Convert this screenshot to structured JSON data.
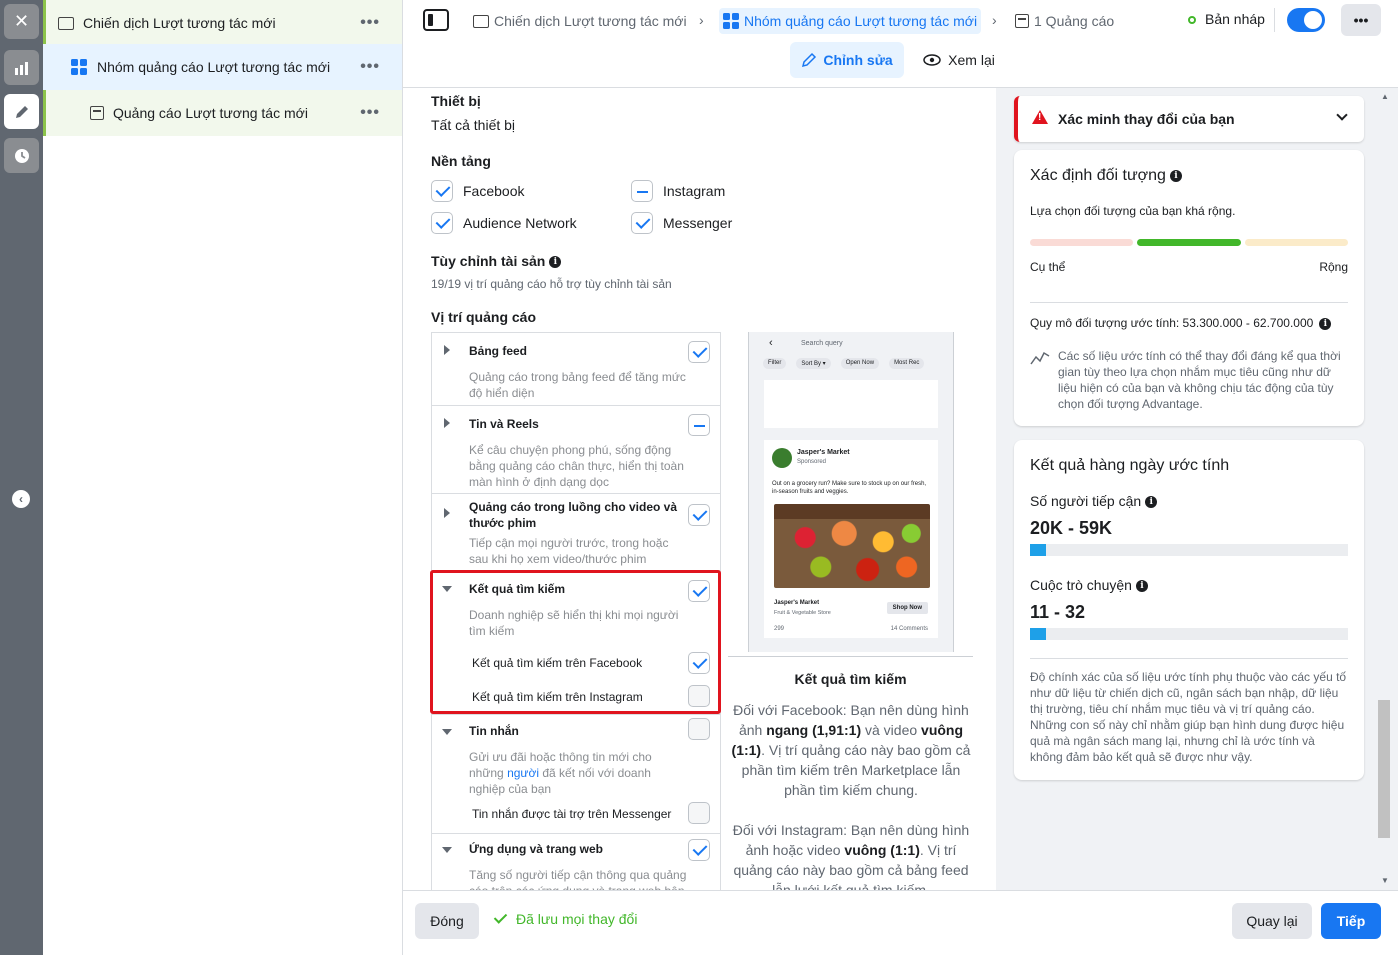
{
  "tree": {
    "campaign": "Chiến dịch Lượt tương tác mới",
    "adset": "Nhóm quảng cáo Lượt tương tác mới",
    "ad": "Quảng cáo Lượt tương tác mới",
    "more": "•••"
  },
  "rail": {
    "close": "✕",
    "collapse": "‹"
  },
  "breadcrumb": {
    "campaign": "Chiến dịch Lượt tương tác mới",
    "adset": "Nhóm quảng cáo Lượt tương tác mới",
    "ad": "1 Quảng cáo",
    "sep": "›"
  },
  "status": {
    "text": "Bản nháp",
    "more": "•••"
  },
  "modes": {
    "edit": "Chỉnh sửa",
    "review": "Xem lại"
  },
  "devices": {
    "label": "Thiết bị",
    "value": "Tất cả thiết bị"
  },
  "platforms": {
    "label": "Nền tảng",
    "items": [
      {
        "label": "Facebook",
        "state": "checked"
      },
      {
        "label": "Instagram",
        "state": "indeterminate"
      },
      {
        "label": "Audience Network",
        "state": "checked"
      },
      {
        "label": "Messenger",
        "state": "checked"
      }
    ]
  },
  "asset_custom": {
    "label": "Tùy chỉnh tài sản",
    "note": "19/19 vị trí quảng cáo hỗ trợ tùy chỉnh tài sản"
  },
  "placements": {
    "label": "Vị trí quảng cáo",
    "items": [
      {
        "title": "Bảng feed",
        "desc": "Quảng cáo trong bảng feed để tăng mức độ hiển diện",
        "state": "checked"
      },
      {
        "title": "Tin và Reels",
        "desc": "Kể câu chuyện phong phú, sống động bằng quảng cáo chân thực, hiển thị toàn màn hình ở định dạng dọc",
        "state": "indeterminate"
      },
      {
        "title": "Quảng cáo trong luồng cho video và thước phim",
        "desc": "Tiếp cận mọi người trước, trong hoặc sau khi họ xem video/thước phim",
        "state": "checked"
      },
      {
        "title": "Kết quả tìm kiếm",
        "desc": "Doanh nghiệp sẽ hiển thị khi mọi người tìm kiếm",
        "state": "checked",
        "sub": [
          {
            "label": "Kết quả tìm kiếm trên Facebook",
            "state": "checked"
          },
          {
            "label": "Kết quả tìm kiếm trên Instagram",
            "state": "off"
          }
        ]
      },
      {
        "title": "Tin nhắn",
        "desc_a": "Gửi ưu đãi hoặc thông tin mới cho những",
        "desc_link": "người",
        "desc_b": "đã kết nối với doanh nghiệp của bạn",
        "state": "off",
        "sub": [
          {
            "label": "Tin nhắn được tài trợ trên Messenger",
            "state": "off"
          }
        ]
      },
      {
        "title": "Ứng dụng và trang web",
        "desc": "Tăng số người tiếp cận thông qua quảng cáo trên các ứng dụng và trang web bên",
        "state": "checked"
      }
    ]
  },
  "preview": {
    "search": "Search query",
    "filters": [
      "Filter",
      "Sort By ▾",
      "Open Now",
      "Most Rec"
    ],
    "advertiser": "Jasper's Market",
    "sponsored": "Sponsored",
    "post_text": "Out on a grocery run? Make sure to stock up on our fresh, in-season fruits and veggies.",
    "store_name": "Jasper's Market",
    "store_sub": "Fruit & Vegetable Store",
    "cta": "Shop Now",
    "reactions": "299",
    "comments": "14 Comments",
    "caption": "Kết quả tìm kiếm",
    "para1_a": "Đối với Facebook: Bạn nên dùng hình ảnh",
    "para1_b1": "ngang (1,91:1)",
    "para1_c": "và video",
    "para1_b2": "vuông (1:1)",
    "para1_d": ". Vị trí quảng cáo này bao gồm cả phần tìm kiếm trên Marketplace lẫn phần tìm kiếm chung.",
    "para2_a": "Đối với Instagram: Bạn nên dùng hình ảnh hoặc video",
    "para2_b": "vuông (1:1)",
    "para2_c": ". Vị trí quảng cáo này bao gồm cả bảng feed lẫn lưới kết quả tìm kiếm."
  },
  "verify": {
    "title": "Xác minh thay đổi của bạn"
  },
  "audience": {
    "title": "Xác định đối tượng",
    "summary": "Lựa chọn đối tượng của bạn khá rộng.",
    "left": "Cụ thể",
    "right": "Rộng",
    "size": "Quy mô đối tượng ước tính: 53.300.000 - 62.700.000",
    "note": "Các số liệu ước tính có thể thay đổi đáng kể qua thời gian tùy theo lựa chọn nhắm mục tiêu cũng như dữ liệu hiện có của bạn và không chịu tác động của tùy chọn đối tượng Advantage.",
    "colors": {
      "low": "#fadbd6",
      "mid": "#42b72a",
      "high": "#fbebc9"
    }
  },
  "results": {
    "title": "Kết quả hàng ngày ước tính",
    "reach_label": "Số người tiếp cận",
    "reach_value": "20K - 59K",
    "conv_label": "Cuộc trò chuyện",
    "conv_value": "11 - 32",
    "reach_level": 0.05,
    "conv_level": 0.05,
    "disclaimer": "Độ chính xác của số liệu ước tính phụ thuộc vào các yếu tố như dữ liệu từ chiến dịch cũ, ngân sách bạn nhập, dữ liệu thị trường, tiêu chí nhắm mục tiêu và vị trí quảng cáo. Những con số này chỉ nhằm giúp bạn hình dung được hiệu quả mà ngân sách mang lại, nhưng chỉ là ước tính và không đảm bảo kết quả sẽ được như vậy."
  },
  "footer": {
    "close": "Đóng",
    "saved": "Đã lưu mọi thay đổi",
    "back": "Quay lại",
    "next": "Tiếp"
  }
}
